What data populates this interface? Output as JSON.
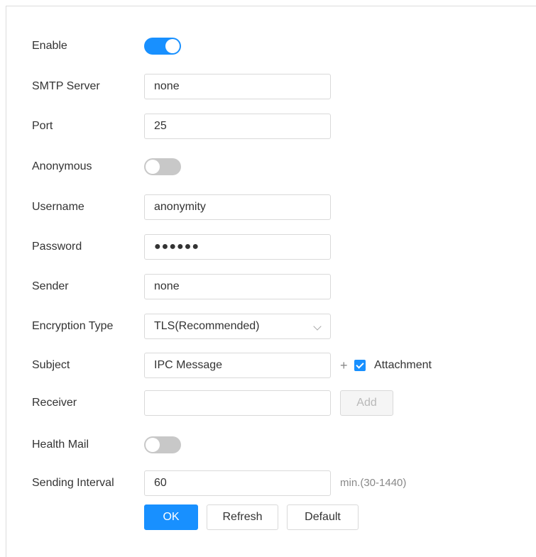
{
  "form": {
    "enable": {
      "label": "Enable",
      "on": true
    },
    "smtp_server": {
      "label": "SMTP Server",
      "value": "none"
    },
    "port": {
      "label": "Port",
      "value": "25"
    },
    "anonymous": {
      "label": "Anonymous",
      "on": false
    },
    "username": {
      "label": "Username",
      "value": "anonymity"
    },
    "password": {
      "label": "Password",
      "value": "●●●●●●"
    },
    "sender": {
      "label": "Sender",
      "value": "none"
    },
    "encryption_type": {
      "label": "Encryption Type",
      "value": "TLS(Recommended)"
    },
    "subject": {
      "label": "Subject",
      "value": "IPC Message",
      "plus": "+",
      "attachment_label": "Attachment",
      "attachment_checked": true
    },
    "receiver": {
      "label": "Receiver",
      "value": "",
      "add_label": "Add"
    },
    "health_mail": {
      "label": "Health Mail",
      "on": false
    },
    "sending_interval": {
      "label": "Sending Interval",
      "value": "60",
      "hint": "min.(30-1440)"
    }
  },
  "actions": {
    "ok": "OK",
    "refresh": "Refresh",
    "default": "Default"
  },
  "colors": {
    "accent": "#1890ff",
    "toggle_off": "#c8c8c8"
  }
}
